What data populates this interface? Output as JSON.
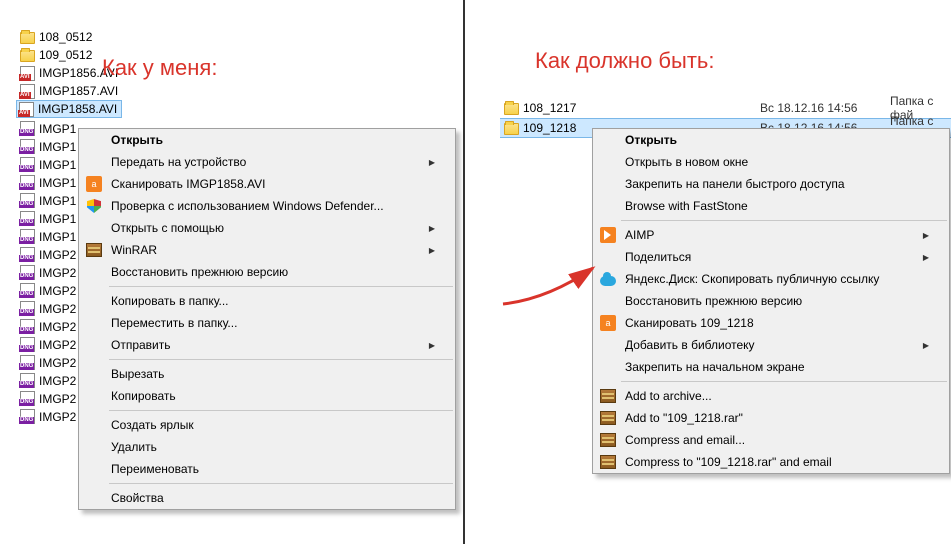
{
  "titles": {
    "left": "Как у меня:",
    "right": "Как должно быть:"
  },
  "left_files": [
    {
      "icon": "folder",
      "label": "108_0512"
    },
    {
      "icon": "folder",
      "label": "109_0512"
    },
    {
      "icon": "avi",
      "label": "IMGP1856.AVI"
    },
    {
      "icon": "avi",
      "label": "IMGP1857.AVI"
    },
    {
      "icon": "avi",
      "label": "IMGP1858.AVI",
      "selected": true
    },
    {
      "icon": "dng",
      "label": "IMGP1"
    },
    {
      "icon": "dng",
      "label": "IMGP1"
    },
    {
      "icon": "dng",
      "label": "IMGP1"
    },
    {
      "icon": "dng",
      "label": "IMGP1"
    },
    {
      "icon": "dng",
      "label": "IMGP1"
    },
    {
      "icon": "dng",
      "label": "IMGP1"
    },
    {
      "icon": "dng",
      "label": "IMGP1"
    },
    {
      "icon": "dng",
      "label": "IMGP2"
    },
    {
      "icon": "dng",
      "label": "IMGP2"
    },
    {
      "icon": "dng",
      "label": "IMGP2"
    },
    {
      "icon": "dng",
      "label": "IMGP2"
    },
    {
      "icon": "dng",
      "label": "IMGP2"
    },
    {
      "icon": "dng",
      "label": "IMGP2"
    },
    {
      "icon": "dng",
      "label": "IMGP2"
    },
    {
      "icon": "dng",
      "label": "IMGP2"
    },
    {
      "icon": "dng",
      "label": "IMGP2"
    },
    {
      "icon": "dng",
      "label": "IMGP2"
    }
  ],
  "right_files": [
    {
      "label": "108_1217",
      "date": "Вс 18.12.16 14:56",
      "type": "Папка с фай"
    },
    {
      "label": "109_1218",
      "date": "Вс 18.12.16 14:56",
      "type": "Папка с фай",
      "selected": true
    }
  ],
  "left_menu": [
    {
      "type": "item",
      "label": "Открыть",
      "bold": true
    },
    {
      "type": "item",
      "label": "Передать на устройство",
      "arrow": true
    },
    {
      "type": "item",
      "label": "Сканировать IMGP1858.AVI",
      "icon": "avast"
    },
    {
      "type": "item",
      "label": "Проверка с использованием Windows Defender...",
      "icon": "shield"
    },
    {
      "type": "item",
      "label": "Открыть с помощью",
      "arrow": true
    },
    {
      "type": "item",
      "label": "WinRAR",
      "icon": "winrar",
      "arrow": true
    },
    {
      "type": "item",
      "label": "Восстановить прежнюю версию"
    },
    {
      "type": "sep"
    },
    {
      "type": "item",
      "label": "Копировать в папку..."
    },
    {
      "type": "item",
      "label": "Переместить в папку..."
    },
    {
      "type": "item",
      "label": "Отправить",
      "arrow": true
    },
    {
      "type": "sep"
    },
    {
      "type": "item",
      "label": "Вырезать"
    },
    {
      "type": "item",
      "label": "Копировать"
    },
    {
      "type": "sep"
    },
    {
      "type": "item",
      "label": "Создать ярлык"
    },
    {
      "type": "item",
      "label": "Удалить"
    },
    {
      "type": "item",
      "label": "Переименовать"
    },
    {
      "type": "sep"
    },
    {
      "type": "item",
      "label": "Свойства"
    }
  ],
  "right_menu": [
    {
      "type": "item",
      "label": "Открыть",
      "bold": true
    },
    {
      "type": "item",
      "label": "Открыть в новом окне"
    },
    {
      "type": "item",
      "label": "Закрепить на панели быстрого доступа"
    },
    {
      "type": "item",
      "label": "Browse with FastStone"
    },
    {
      "type": "sep"
    },
    {
      "type": "item",
      "label": "AIMP",
      "icon": "aimp",
      "arrow": true
    },
    {
      "type": "item",
      "label": "Поделиться",
      "arrow": true
    },
    {
      "type": "item",
      "label": "Яндекс.Диск: Скопировать публичную ссылку",
      "icon": "yadisk"
    },
    {
      "type": "item",
      "label": "Восстановить прежнюю версию"
    },
    {
      "type": "item",
      "label": "Сканировать 109_1218",
      "icon": "avast"
    },
    {
      "type": "item",
      "label": "Добавить в библиотеку",
      "arrow": true
    },
    {
      "type": "item",
      "label": "Закрепить на начальном экране"
    },
    {
      "type": "sep"
    },
    {
      "type": "item",
      "label": "Add to archive...",
      "icon": "winrar"
    },
    {
      "type": "item",
      "label": "Add to \"109_1218.rar\"",
      "icon": "winrar"
    },
    {
      "type": "item",
      "label": "Compress and email...",
      "icon": "winrar"
    },
    {
      "type": "item",
      "label": "Compress to \"109_1218.rar\" and email",
      "icon": "winrar"
    }
  ]
}
